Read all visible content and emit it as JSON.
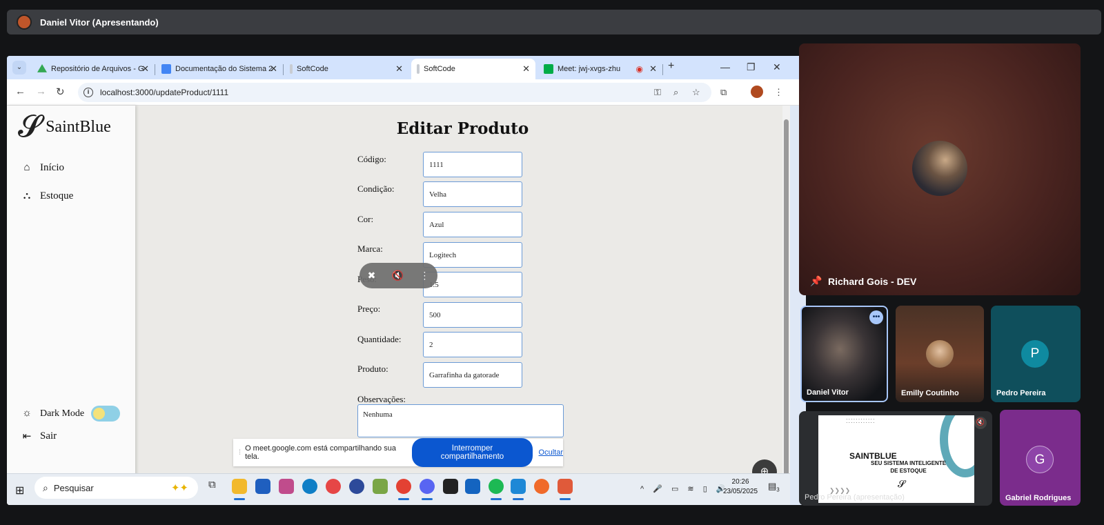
{
  "meet": {
    "presenter_title": "Daniel Vitor (Apresentando)"
  },
  "browser": {
    "tabs": [
      {
        "title": "Repositório de Arquivos - G",
        "favicon": "drive-icon",
        "color": "#34a853"
      },
      {
        "title": "Documentação do Sistema 2",
        "favicon": "docs-icon",
        "color": "#4285f4"
      },
      {
        "title": "SoftCode",
        "favicon": "softcode-icon",
        "color": "#9aa0a6"
      },
      {
        "title": "SoftCode",
        "favicon": "softcode-icon",
        "color": "#9aa0a6",
        "active": true
      },
      {
        "title": "Meet: jwj-xvgs-zhu",
        "favicon": "meet-icon",
        "color": "#00ac47"
      }
    ],
    "url": "localhost:3000/updateProduct/1111"
  },
  "app": {
    "brand": "SaintBlue",
    "nav": [
      {
        "label": "Início",
        "icon": "home-icon"
      },
      {
        "label": "Estoque",
        "icon": "boxes-icon"
      }
    ],
    "dark_mode_label": "Dark Mode",
    "logout_label": "Sair",
    "form": {
      "title": "Editar Produto",
      "fields": [
        {
          "label": "Código:",
          "value": "1111"
        },
        {
          "label": "Condição:",
          "value": "Velha"
        },
        {
          "label": "Cor:",
          "value": "Azul"
        },
        {
          "label": "Marca:",
          "value": "Logitech"
        },
        {
          "label": "Peso:",
          "value": "1.5"
        },
        {
          "label": "Preço:",
          "value": "500"
        },
        {
          "label": "Quantidade:",
          "value": "2"
        },
        {
          "label": "Produto:",
          "value": "Garrafinha da gatorade"
        }
      ],
      "obs_label": "Observações:",
      "obs_value": "Nenhuma"
    }
  },
  "share_bar": {
    "message": "O meet.google.com está compartilhando sua tela.",
    "stop_label": "Interromper compartilhamento",
    "hide_label": "Ocultar"
  },
  "taskbar": {
    "search_placeholder": "Pesquisar",
    "time": "20:26",
    "date": "23/05/2025",
    "notif_count": "3"
  },
  "participants": {
    "pinned": "Richard Gois - DEV",
    "tiles": [
      {
        "name": "Daniel Vitor"
      },
      {
        "name": "Emilly Coutinho"
      },
      {
        "name": "Pedro Pereira",
        "initial": "P"
      },
      {
        "name": "Pedro Pereira (apresentação)"
      },
      {
        "name": "Gabriel Rodrigues",
        "initial": "G"
      }
    ]
  },
  "slide": {
    "title": "SAINTBLUE",
    "subtitle_line1": "SEU SISTEMA INTELIGENTE",
    "subtitle_line2": "DE ESTOQUE"
  },
  "colors": {
    "accent": "#0b57d0",
    "input_border": "#6a9ad6",
    "tab_strip": "#d3e3fd"
  }
}
